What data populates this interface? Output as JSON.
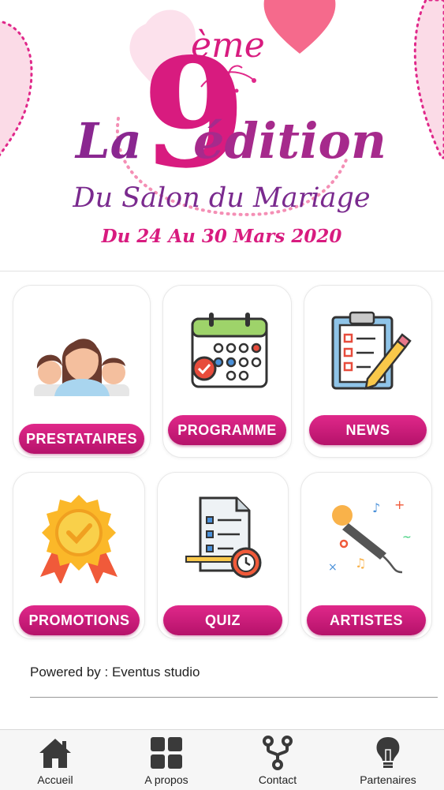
{
  "banner": {
    "edition_number": "9",
    "edition_suffix": "ème",
    "edition_la": "La",
    "edition_word": "édition",
    "subtitle": "Du Salon du Mariage",
    "dates": "Du 24 Au 30 Mars 2020"
  },
  "menu": {
    "prestataires": "PRESTATAIRES",
    "programme": "PROGRAMME",
    "news": "NEWS",
    "promotions": "PROMOTIONS",
    "quiz": "QUIZ",
    "artistes": "ARTISTES"
  },
  "footer": {
    "powered": "Powered by : Eventus studio"
  },
  "tabbar": {
    "accueil": "Accueil",
    "apropos": "A propos",
    "contact": "Contact",
    "partenaires": "Partenaires"
  },
  "colors": {
    "accent": "#d81b7f",
    "purple": "#7a2a8e",
    "heart": "#f56a8c"
  },
  "icons": {
    "prestataires": "people-group-icon",
    "programme": "calendar-icon",
    "news": "clipboard-checklist-icon",
    "promotions": "badge-ribbon-icon",
    "quiz": "quiz-document-icon",
    "artistes": "microphone-icon",
    "accueil": "home-icon",
    "apropos": "grid-icon",
    "contact": "share-fork-icon",
    "partenaires": "lightbulb-icon"
  }
}
